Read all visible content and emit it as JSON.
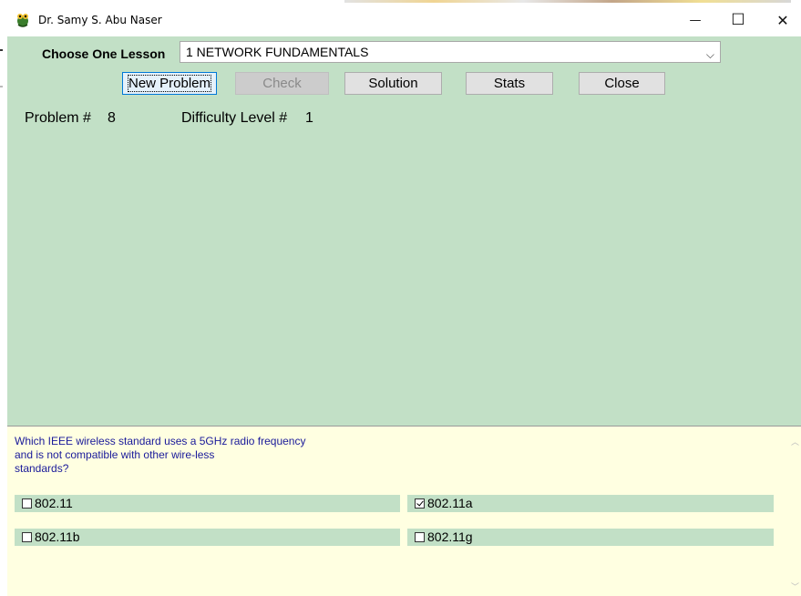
{
  "window": {
    "title": "Dr. Samy S. Abu Naser",
    "minimize": "—",
    "maximize": "☐",
    "close": "✕"
  },
  "lesson": {
    "label": "Choose One Lesson",
    "selected": "1 NETWORK FUNDAMENTALS",
    "chevron": "⌵"
  },
  "toolbar": {
    "new_problem": "New Problem",
    "check": "Check",
    "solution": "Solution",
    "stats": "Stats",
    "close": "Close"
  },
  "problem": {
    "number_label": "Problem #",
    "number": "8",
    "difficulty_label": "Difficulty Level #",
    "difficulty": "1"
  },
  "question": {
    "line1": "Which IEEE wireless standard uses a 5GHz radio frequency",
    "line2": "and is not compatible with other wire-less",
    "line3": "standards?"
  },
  "options": [
    {
      "label": "802.11",
      "checked": false
    },
    {
      "label": "802.11a",
      "checked": true
    },
    {
      "label": "802.11b",
      "checked": false
    },
    {
      "label": "802.11g",
      "checked": false
    }
  ],
  "colors": {
    "form_bg": "#c2e0c6",
    "panel_bg": "#ffffe1",
    "question_text": "#1a1a9a",
    "focus_border": "#0078d7"
  },
  "icons": {
    "app": "frog-app-icon"
  }
}
